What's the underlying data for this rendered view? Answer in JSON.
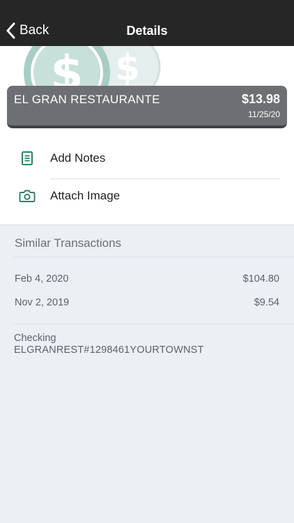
{
  "nav": {
    "back_label": "Back",
    "title": "Details"
  },
  "transaction": {
    "merchant": "EL GRAN RESTAURANTE",
    "amount": "$13.98",
    "date": "11/25/20"
  },
  "actions": {
    "notes_label": "Add Notes",
    "image_label": "Attach Image"
  },
  "similar": {
    "title": "Similar Transactions",
    "items": [
      {
        "date": "Feb 4, 2020",
        "amount": "$104.80"
      },
      {
        "date": "Nov 2, 2019",
        "amount": "$9.54"
      }
    ]
  },
  "account": {
    "name": "Checking",
    "description": "ELGRANREST#1298461YOURTOWNST"
  },
  "colors": {
    "nav_bg": "#262626",
    "card_bg": "#6d6f73",
    "accent": "#2e7d6c",
    "page_bg": "#eceff4"
  },
  "icons": [
    "chevron-left-icon",
    "coins-icon",
    "notes-icon",
    "camera-icon"
  ]
}
